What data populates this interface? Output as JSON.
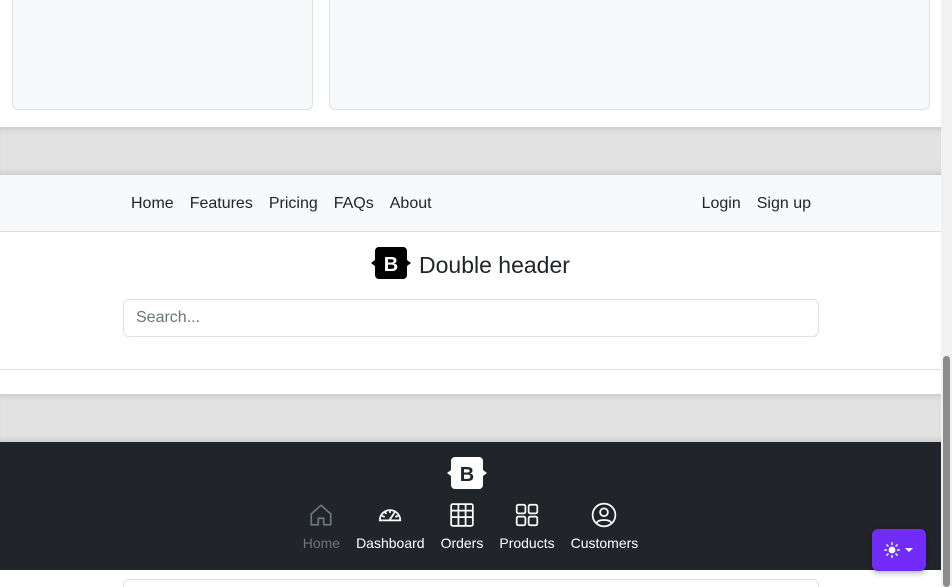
{
  "nav": {
    "left_links": [
      "Home",
      "Features",
      "Pricing",
      "FAQs",
      "About"
    ],
    "right_links": [
      "Login",
      "Sign up"
    ]
  },
  "header": {
    "brand_icon": "bootstrap-logo-icon",
    "title": "Double header",
    "search_placeholder": "Search..."
  },
  "dark_nav": {
    "logo_icon": "bootstrap-logo-icon",
    "items": [
      {
        "label": "Home",
        "icon": "home-icon",
        "muted": true
      },
      {
        "label": "Dashboard",
        "icon": "speedometer-icon",
        "muted": false
      },
      {
        "label": "Orders",
        "icon": "table-icon",
        "muted": false
      },
      {
        "label": "Products",
        "icon": "grid-icon",
        "muted": false
      },
      {
        "label": "Customers",
        "icon": "person-circle-icon",
        "muted": false
      }
    ]
  },
  "theme_toggle": {
    "icon": "sun-icon",
    "caret": "caret-down-icon"
  },
  "colors": {
    "dark_bg": "#212529",
    "nav_bg": "#f8f9fa",
    "accent": "#712cf9",
    "muted": "#6c757d"
  }
}
